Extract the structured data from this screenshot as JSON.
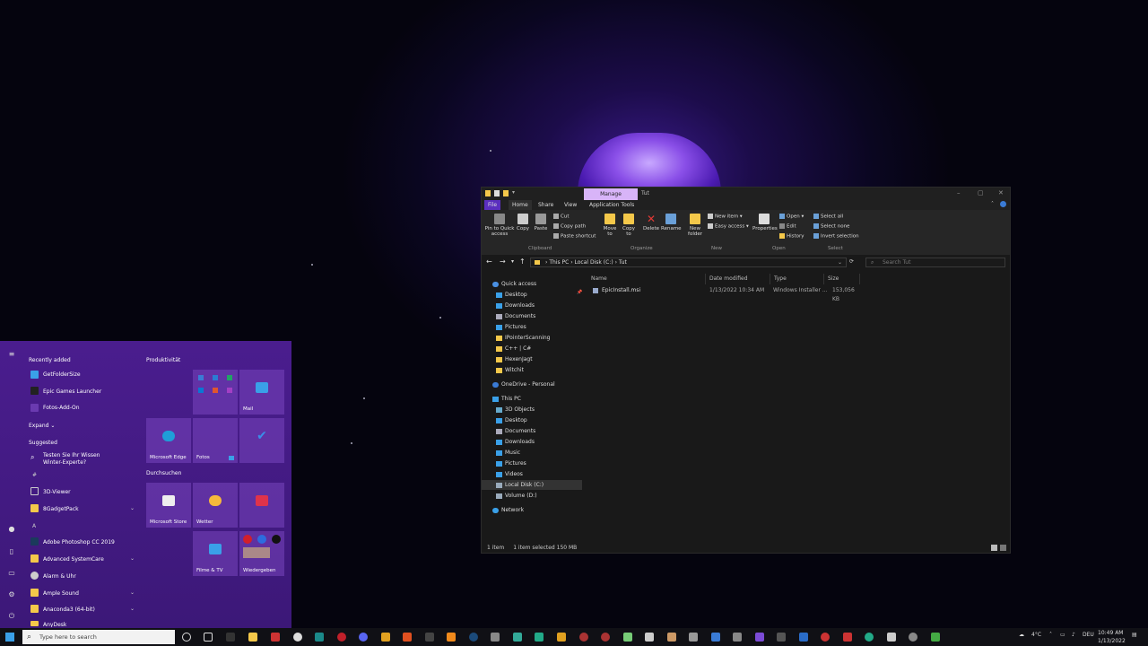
{
  "explorer": {
    "contextual_tab": "Manage",
    "window_title": "Tut",
    "tabs": [
      "File",
      "Home",
      "Share",
      "View",
      "Application Tools"
    ],
    "ribbon": {
      "pin": "Pin to Quick access",
      "copy": "Copy",
      "paste": "Paste",
      "cut": "Cut",
      "copy_path": "Copy path",
      "paste_shortcut": "Paste shortcut",
      "move_to": "Move to",
      "copy_to": "Copy to",
      "delete": "Delete",
      "rename": "Rename",
      "new_folder": "New folder",
      "new_item": "New item",
      "easy_access": "Easy access",
      "properties": "Properties",
      "open": "Open",
      "edit": "Edit",
      "history": "History",
      "select_all": "Select all",
      "select_none": "Select none",
      "invert_selection": "Invert selection",
      "groups": {
        "clipboard": "Clipboard",
        "organize": "Organize",
        "new": "New",
        "open": "Open",
        "select": "Select"
      }
    },
    "address": {
      "parts": [
        "This PC",
        "Local Disk (C:)",
        "Tut"
      ],
      "search_placeholder": "Search Tut"
    },
    "nav": {
      "quick_access": "Quick access",
      "quick_items": [
        "Desktop",
        "Downloads",
        "Documents",
        "Pictures",
        "IPointerScanning",
        "C++ | C#",
        "HexenJagt",
        "Witchit"
      ],
      "onedrive": "OneDrive - Personal",
      "this_pc": "This PC",
      "pc_items": [
        "3D Objects",
        "Desktop",
        "Documents",
        "Downloads",
        "Music",
        "Pictures",
        "Videos",
        "Local Disk (C:)",
        "Volume (D:)"
      ],
      "network": "Network"
    },
    "columns": [
      "Name",
      "Date modified",
      "Type",
      "Size"
    ],
    "files": [
      {
        "name": "EpicInstall.msi",
        "date": "1/13/2022 10:34 AM",
        "type": "Windows Installer ...",
        "size": "153,056 KB"
      }
    ],
    "status": {
      "items": "1 item",
      "selected": "1 item selected  150 MB"
    }
  },
  "start": {
    "recently_added": "Recently added",
    "recent": [
      "GetFolderSize",
      "Epic Games Launcher",
      "Fotos-Add-On"
    ],
    "expand": "Expand",
    "suggested": "Suggested",
    "suggestion": "Testen Sie Ihr Wissen",
    "suggestion2": "Winter-Experte?",
    "hash": "#",
    "apps_hash": [
      "3D-Viewer",
      "8GadgetPack"
    ],
    "letter_a": "A",
    "apps_a": [
      "Adobe Photoshop CC 2019",
      "Advanced SystemCare",
      "Alarm & Uhr",
      "Ample Sound",
      "Anaconda3 (64-bit)",
      "AnyDesk"
    ],
    "group_productivity": "Produktivität",
    "group_browse": "Durchsuchen",
    "tiles": {
      "mail": "Mail",
      "edge": "Microsoft Edge",
      "fotos": "Fotos",
      "store": "Microsoft Store",
      "wetter": "Wetter",
      "filme": "Filme & TV",
      "wiedergeben": "Wiedergeben"
    }
  },
  "taskbar": {
    "search_placeholder": "Type here to search",
    "temp": "4°C",
    "lang": "DEU",
    "time": "10:49 AM",
    "date": "1/13/2022"
  }
}
